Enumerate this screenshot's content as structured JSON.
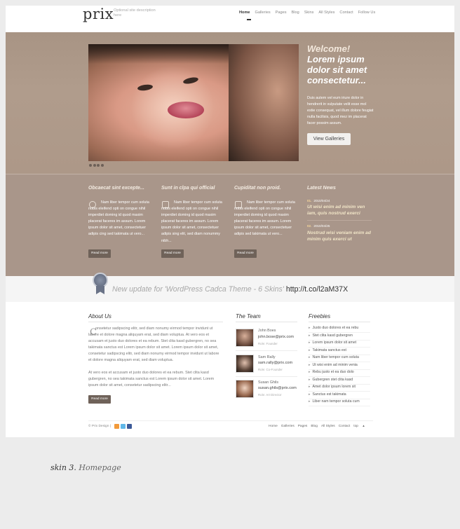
{
  "header": {
    "logo": "prix",
    "tagline": "Optional site description here",
    "nav": [
      "Home",
      "Galleries",
      "Pages",
      "Blog",
      "Skins",
      "All Styles",
      "Contact",
      "Follow Us"
    ]
  },
  "hero": {
    "welcome_line1": "Welcome!",
    "welcome_line2": "Lorem ipsum dolor sit amet consectetur...",
    "body": "Duis autem vel eum iriure dolor in hendrerit in vulputate velit esse mol estie consequat, vel illum dolore feugiat nulla facilisis, quod mez im placerat facer possim assum.",
    "button": "View Galleries"
  },
  "features": [
    {
      "title": "Obcaecat sint excepte...",
      "text": "Nam liber tempor cum soluta nobis eleifend opti on congue nihil imperdiet doming id quod maxim placerat faceres im assum. Lorem ipsum dolor sit amet, consectetuer adipis cing sed takimata ut vero...",
      "button": "Read more"
    },
    {
      "title": "Sunt in clpa qui official",
      "text": "Nam liber tempor cum soluta nobis eleifend opti on congue nihil imperdiet doming id quod maxim placerat faceres im assum. Lorem ipsum dolor sit amet, consectetuer adipis sing elit, sed diam nonummy nibh...",
      "button": "Read more"
    },
    {
      "title": "Cupiditat non proid.",
      "text": "Nam liber tempor cum soluta nobis eleifend opti on congue nihil imperdiet doming id quod maxim placerat faceres im assum. Lorem ipsum dolor sit amet, consectetuer adipis sed takimata ut vero...",
      "button": "Read more"
    }
  ],
  "news": {
    "title": "Latest News",
    "items": [
      {
        "num": "01.",
        "date": "2010/04/24",
        "text": "Ut wisi enim ad minim ven iam, quis nostrud exerci"
      },
      {
        "num": "02.",
        "date": "2010/04/25",
        "text": "Nostrud wisi veniam enim ad minim quis exerci ut"
      }
    ]
  },
  "tweet": {
    "text": "New update for 'WordPress Cadca Theme - 6 Skins'",
    "link": "http://t.co/l2aM37X"
  },
  "about": {
    "title": "About Us",
    "dropcap": "C",
    "p1": "onsetetur sadipscing elitr, sed diam nonumy eirmod tempor invidunt ut labore et dolore magna aliquyam erat, sed diam voluptua. At vero eos et accusam et justo duo dolores et ea rebum. Stet clita kasd gubergren, no sea takimata sanctus est Lorem ipsum dolor sit amet. Lorem ipsum dolor sit amet, consetetur sadipscing elitr, sed diam nonumy eirmod tempor invidunt ut labore et dolore magna aliquyam erat, sed diam voluptua.",
    "p2": "At vero eos et accusam et justo duo dolores et ea rebum. Stet clita kasd gubergren, no sea takimata sanctus est Lorem ipsum dolor sit amet. Lorem ipsum dolor sit amet, consetetur sadipscing elitr...",
    "button": "Read more"
  },
  "team": {
    "title": "The Team",
    "members": [
      {
        "name": "John Boes",
        "email": "john.bose@prix.com",
        "role": "Role: Founder"
      },
      {
        "name": "Sam Rally",
        "email": "sam.rally@prix.com",
        "role": "Role: Co-Founder"
      },
      {
        "name": "Susan Ghils",
        "email": "susan.ghils@prix.com",
        "role": "Role: Art Director"
      }
    ]
  },
  "freebies": {
    "title": "Freebies",
    "items": [
      "Justo duo dolores et ea rebu",
      "Stet clita kasd gubergren",
      "Lorem ipsum dolor sit amet",
      "Takimata sanctus est",
      "Nam liber tempor cum soluta",
      "Ut wisi enim ad minim venia",
      "Rebu justo et ea duo dolo",
      "Gubergren stet clita kasd",
      "Amet dolor ipsum lorem sit",
      "Sanctus est takimata",
      "Liber nam tempor soluta cum"
    ]
  },
  "footer": {
    "copyright": "© Prix Design |",
    "nav": [
      "Home",
      "Galleries",
      "Pages",
      "Blog",
      "All Styles",
      "Contact",
      "top"
    ]
  },
  "caption": {
    "main": "skin 3.",
    "sub": "Homepage"
  },
  "colors": {
    "hero_band": "#a89484",
    "features_band": "#a9968a",
    "button_dark": "#6f6259",
    "news_highlight": "#f2e6c8"
  }
}
